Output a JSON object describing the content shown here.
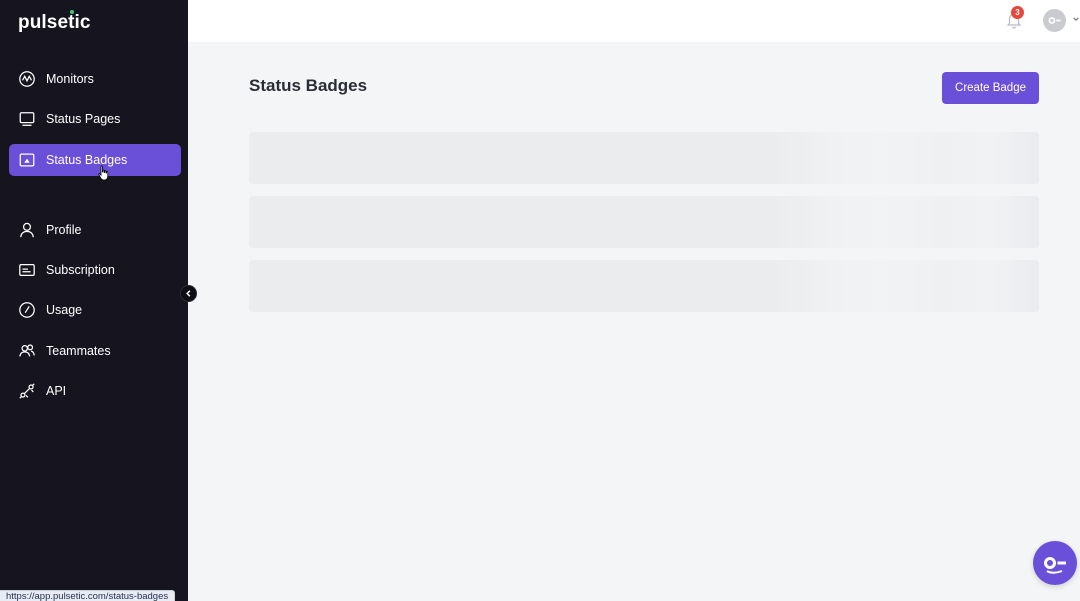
{
  "app": {
    "logo_text": "pulsetic"
  },
  "sidebar": {
    "items": [
      {
        "label": "Monitors",
        "icon": "monitor-wave-icon",
        "active": false
      },
      {
        "label": "Status Pages",
        "icon": "screen-icon",
        "active": false
      },
      {
        "label": "Status Badges",
        "icon": "badge-image-icon",
        "active": true
      },
      {
        "label": "Profile",
        "icon": "user-icon",
        "active": false
      },
      {
        "label": "Subscription",
        "icon": "card-icon",
        "active": false
      },
      {
        "label": "Usage",
        "icon": "gauge-icon",
        "active": false
      },
      {
        "label": "Teammates",
        "icon": "users-icon",
        "active": false
      },
      {
        "label": "API",
        "icon": "plug-icon",
        "active": false
      }
    ]
  },
  "topbar": {
    "notification_count": "3"
  },
  "main": {
    "title": "Status Badges",
    "create_button": "Create Badge",
    "skeleton_rows": 3
  },
  "browser": {
    "status_url": "https://app.pulsetic.com/status-badges"
  },
  "colors": {
    "accent": "#6a4fd9",
    "sidebar_bg": "#16141f",
    "badge_red": "#e5483a"
  }
}
